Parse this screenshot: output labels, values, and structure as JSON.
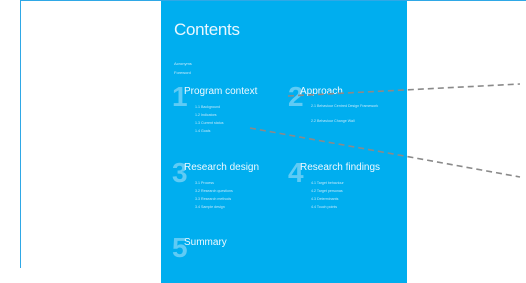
{
  "page": {
    "title": "Contents",
    "front_matter": [
      "Acronyms",
      "Foreword"
    ]
  },
  "sections": [
    {
      "number": "1",
      "title": "Program context",
      "items": [
        "1.1 Background",
        "1.2 Indicators",
        "1.3 Current status",
        "1.4 Goals"
      ]
    },
    {
      "number": "2",
      "title": "Approach",
      "items": [
        "2.1 Behaviour Centred Design Framework",
        "2.2 Behaviour Change Wall"
      ]
    },
    {
      "number": "3",
      "title": "Research design",
      "items": [
        "3.1 Process",
        "3.2 Research questions",
        "3.3 Research methods",
        "3.4 Sample design"
      ]
    },
    {
      "number": "4",
      "title": "Research findings",
      "items": [
        "4.1 Target behaviour",
        "4.2 Target personas",
        "4.3 Determinants",
        "4.4 Touch points"
      ]
    },
    {
      "number": "5",
      "title": "Summary",
      "items": []
    }
  ],
  "colors": {
    "page_background": "#00aeef",
    "frame_line": "#2fa8e6",
    "leader_line": "#8a8a8a"
  }
}
